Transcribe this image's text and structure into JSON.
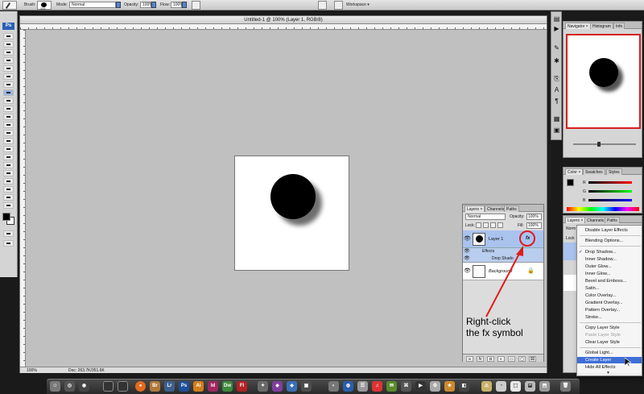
{
  "options_bar": {
    "brush_label": "Brush:",
    "brush_size": "121",
    "mode_label": "Mode:",
    "mode_value": "Normal",
    "opacity_label": "Opacity:",
    "opacity_value": "100%",
    "flow_label": "Flow:",
    "flow_value": "100%",
    "workspace_label": "Workspace ▾"
  },
  "document": {
    "title": "Untitled-1 @ 100% (Layer 1, RGB/8)",
    "zoom": "100%",
    "doc_size": "Doc: 263.7K/351.6K"
  },
  "layers_panel": {
    "tabs": [
      "Layers ×",
      "Channels",
      "Paths"
    ],
    "blend_mode": "Normal",
    "opacity_label": "Opacity:",
    "opacity_value": "100%",
    "lock_label": "Lock:",
    "fill_label": "Fill:",
    "fill_value": "100%",
    "layer1_name": "Layer 1",
    "fx_label": "fx",
    "effects_label": "Effects",
    "drop_shadow_label": "Drop Shado",
    "background_name": "Background",
    "footer_icons": [
      "link-icon",
      "fx-icon",
      "mask-icon",
      "adjustment-icon",
      "folder-icon",
      "new-layer-icon",
      "trash-icon"
    ]
  },
  "dock": {
    "navigator_tabs": [
      "Navigator ×",
      "Histogram",
      "Info"
    ],
    "color_tabs": [
      "Color ×",
      "Swatches",
      "Styles"
    ],
    "color_channels": [
      "R",
      "G",
      "B"
    ],
    "layers2_tabs": [
      "Layers ×",
      "Channels",
      "Paths"
    ],
    "layers2_mode": "Norm",
    "layers2_lock": "Lock"
  },
  "context_menu": {
    "items": [
      {
        "label": "Disable Layer Effects",
        "state": "normal"
      },
      {
        "label": "Blending Options...",
        "state": "normal"
      },
      {
        "label": "Drop Shadow...",
        "state": "checked"
      },
      {
        "label": "Inner Shadow...",
        "state": "normal"
      },
      {
        "label": "Outer Glow...",
        "state": "normal"
      },
      {
        "label": "Inner Glow...",
        "state": "normal"
      },
      {
        "label": "Bevel and Emboss...",
        "state": "normal"
      },
      {
        "label": "Satin...",
        "state": "normal"
      },
      {
        "label": "Color Overlay...",
        "state": "normal"
      },
      {
        "label": "Gradient Overlay...",
        "state": "normal"
      },
      {
        "label": "Pattern Overlay...",
        "state": "normal"
      },
      {
        "label": "Stroke...",
        "state": "normal"
      },
      {
        "label": "Copy Layer Style",
        "state": "normal"
      },
      {
        "label": "Paste Layer Style",
        "state": "disabled"
      },
      {
        "label": "Clear Layer Style",
        "state": "normal"
      },
      {
        "label": "Global Light...",
        "state": "normal"
      },
      {
        "label": "Create Layer",
        "state": "highlighted"
      },
      {
        "label": "Hide All Effects",
        "state": "normal"
      }
    ],
    "check_mark": "✓",
    "more_arrow": "▼"
  },
  "annotation": {
    "line1": "Right-click",
    "line2": "the fx symbol",
    "color": "#e01b1b"
  },
  "toolbox": {
    "badge": "Ps"
  },
  "mac_dock": {
    "apps": [
      "Br",
      "Lr",
      "Ps",
      "Ai",
      "Id",
      "Dw",
      "Fl"
    ]
  },
  "colors": {
    "accent": "#3d6fd6",
    "annotation_red": "#e01b1b",
    "canvas_gray": "#c0c0c0"
  }
}
